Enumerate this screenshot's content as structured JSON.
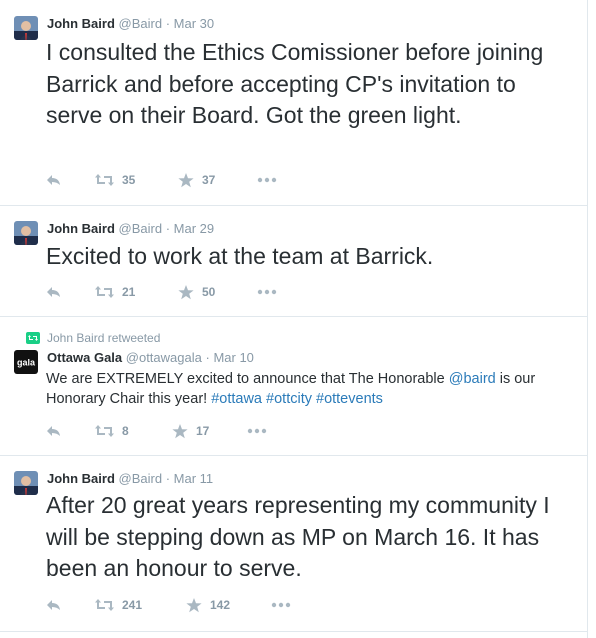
{
  "tweets": [
    {
      "author_name": "John Baird",
      "author_handle": "@Baird",
      "separator": "·",
      "time": "Mar 30",
      "text": "I consulted the Ethics Comissioner before joining Barrick and before accepting CP's invitation to serve on their Board. Got the green light.",
      "retweets": "35",
      "favorites": "37",
      "avatar_icon": "person-avatar"
    },
    {
      "author_name": "John Baird",
      "author_handle": "@Baird",
      "separator": "·",
      "time": "Mar 29",
      "text": "Excited to work at the team at Barrick.",
      "retweets": "21",
      "favorites": "50",
      "avatar_icon": "person-avatar"
    },
    {
      "retweet_context": "John Baird retweeted",
      "author_name": "Ottawa Gala",
      "author_handle": "@ottawagala",
      "separator": "·",
      "time": "Mar 10",
      "text_pre": "We are EXTREMELY excited to announce that The Honorable ",
      "mention": "@baird",
      "text_mid": " is our Honorary Chair this year!  ",
      "hashtags": [
        "#ottawa",
        "#ottcity",
        "#ottevents"
      ],
      "retweets": "8",
      "favorites": "17",
      "avatar_icon": "gala-logo",
      "avatar_text": "gala"
    },
    {
      "author_name": "John Baird",
      "author_handle": "@Baird",
      "separator": "·",
      "time": "Mar 11",
      "text": "After 20 great years representing my community I will be stepping down as MP on March 16.  It has been an honour to serve.",
      "retweets": "241",
      "favorites": "142",
      "avatar_icon": "person-avatar"
    }
  ],
  "icons": {
    "reply": "reply-icon",
    "retweet": "retweet-icon",
    "favorite": "star-icon",
    "more": "more-icon"
  },
  "colors": {
    "link": "#2b7bb9",
    "meta": "#8899a6",
    "text": "#292f33",
    "border": "#e1e8ed",
    "retweet_context_icon": "#19cf86"
  }
}
